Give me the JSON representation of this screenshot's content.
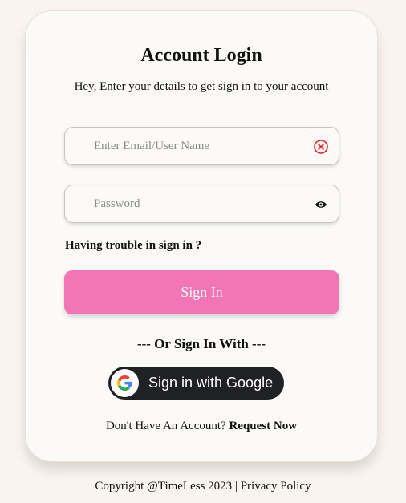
{
  "login": {
    "title": "Account Login",
    "subtitle": "Hey, Enter your details to get sign in to your account",
    "email_placeholder": "Enter Email/User Name",
    "password_placeholder": "Password",
    "trouble_link": "Having trouble in sign in ?",
    "signin_button": "Sign In",
    "divider": "--- Or Sign In With ---",
    "google_button": "Sign in with Google",
    "no_account_text": "Don't Have An Account?",
    "request_link": "Request Now"
  },
  "footer": {
    "copyright": "Copyright @TimeLess 2023 |",
    "privacy": "Privacy Policy"
  },
  "icons": {
    "clear": "clear-circle-x-icon",
    "visibility": "eye-icon",
    "google": "google-logo-icon"
  },
  "colors": {
    "page_background": "#fbf3ee",
    "card_background": "#fbfaf7",
    "primary_button": "#f276b6",
    "google_button": "#202124",
    "clear_icon": "#e0202a"
  }
}
